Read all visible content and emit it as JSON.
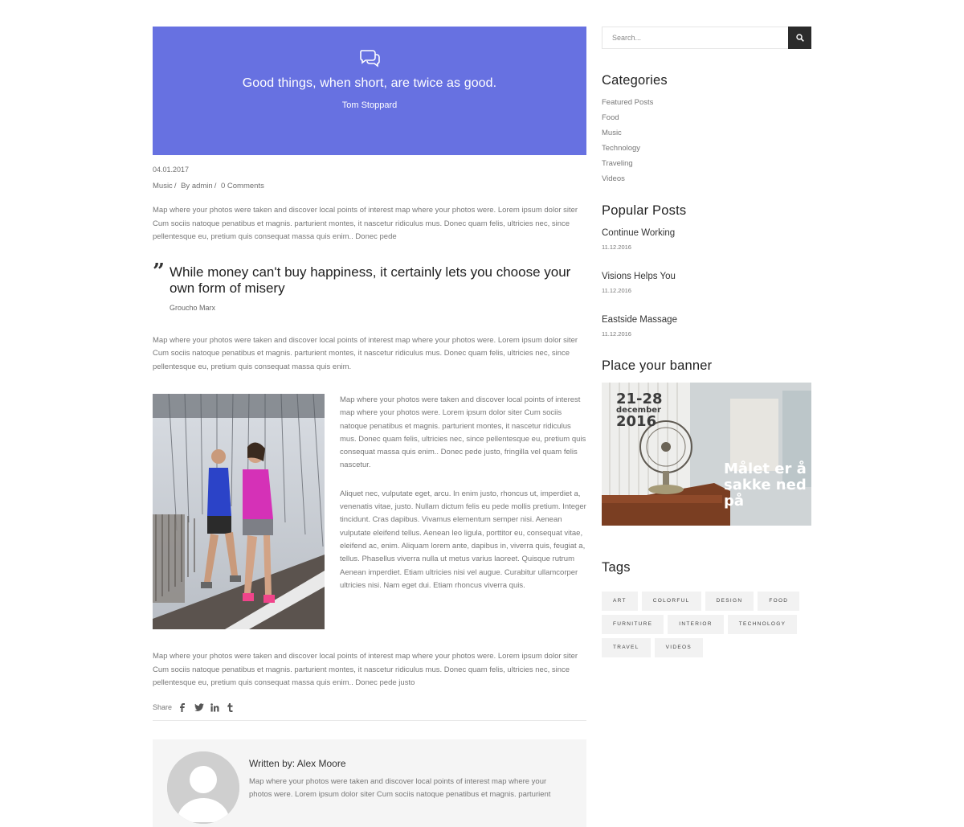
{
  "quote_banner": {
    "text": "Good things, when short, are twice as good.",
    "author": "Tom Stoppard",
    "bg_color": "#6771e1",
    "icon": "speech-bubbles-icon"
  },
  "post": {
    "date": "04.01.2017",
    "category": "Music",
    "by_prefix": "By",
    "author": "admin",
    "comments": "0 Comments",
    "paragraph_1": "Map where your photos were taken and discover local points of interest map where your photos were. Lorem ipsum dolor siter Cum sociis natoque penatibus et magnis. parturient montes, it nascetur ridiculus mus. Donec quam felis, ultricies nec, since pellentesque eu, pretium quis consequat massa quis enim.. Donec pede",
    "blockquote": {
      "text": "While money can't buy happiness, it certainly lets you choose your own form of misery",
      "author": "Groucho Marx"
    },
    "paragraph_2": "Map where your photos were taken and discover local points of interest map where your photos were. Lorem ipsum dolor siter Cum sociis natoque penatibus et magnis. parturient montes, it nascetur ridiculus mus. Donec quam felis, ultricies nec, since pellentesque eu, pretium quis consequat massa quis enim.",
    "media_text_1": "Map where your photos were taken and discover local points of interest map where your photos were. Lorem ipsum dolor siter Cum sociis natoque penatibus et magnis. parturient montes, it nascetur ridiculus mus. Donec quam felis, ultricies nec, since pellentesque eu, pretium quis consequat  massa quis enim.. Donec pede justo, fringilla vel quam felis nascetur.",
    "media_text_2": "Aliquet nec, vulputate eget, arcu. In enim justo, rhoncus ut, imperdiet a, venenatis vitae, justo. Nullam dictum felis eu pede mollis pretium. Integer tincidunt. Cras dapibus. Vivamus elementum semper nisi. Aenean vulputate eleifend tellus. Aenean leo ligula, porttitor eu, consequat vitae, eleifend ac, enim. Aliquam lorem ante, dapibus in, viverra quis, feugiat a, tellus. Phasellus viverra nulla ut metus varius laoreet. Quisque rutrum Aenean imperdiet. Etiam ultricies nisi vel augue. Curabitur ullamcorper ultricies nisi. Nam eget dui. Etiam rhoncus viverra quis.",
    "paragraph_3": "Map where your photos were taken and discover local points of interest map where your photos were. Lorem ipsum dolor siter Cum sociis natoque penatibus et magnis. parturient montes, it nascetur ridiculus mus. Donec quam felis, ultricies nec, since pellentesque eu, pretium quis consequat massa quis enim.. Donec pede justo",
    "share_label": "Share",
    "share_icons": [
      "facebook-icon",
      "twitter-icon",
      "linkedin-icon",
      "tumblr-icon"
    ]
  },
  "author_box": {
    "written_by": "Written by: Alex Moore",
    "bio": "Map where your photos were taken and discover local points of interest map where your photos were. Lorem ipsum dolor siter Cum sociis natoque penatibus et magnis. parturient"
  },
  "sidebar": {
    "search_placeholder": "Search...",
    "categories_title": "Categories",
    "categories": [
      "Featured Posts",
      "Food",
      "Music",
      "Technology",
      "Traveling",
      "Videos"
    ],
    "popular_title": "Popular Posts",
    "popular_posts": [
      {
        "title": "Continue Working",
        "date": "11.12.2016"
      },
      {
        "title": "Visions Helps You",
        "date": "11.12.2016"
      },
      {
        "title": "Eastside Massage",
        "date": "11.12.2016"
      }
    ],
    "banner_title": "Place your banner",
    "banner": {
      "dates": "21-28",
      "month": "december",
      "year": "2016",
      "slogan": "Målet er å sakke ned på"
    },
    "tags_title": "Tags",
    "tags": [
      "ART",
      "COLORFUL",
      "DESIGN",
      "FOOD",
      "FURNITURE",
      "INTERIOR",
      "TECHNOLOGY",
      "TRAVEL",
      "VIDEOS"
    ]
  }
}
